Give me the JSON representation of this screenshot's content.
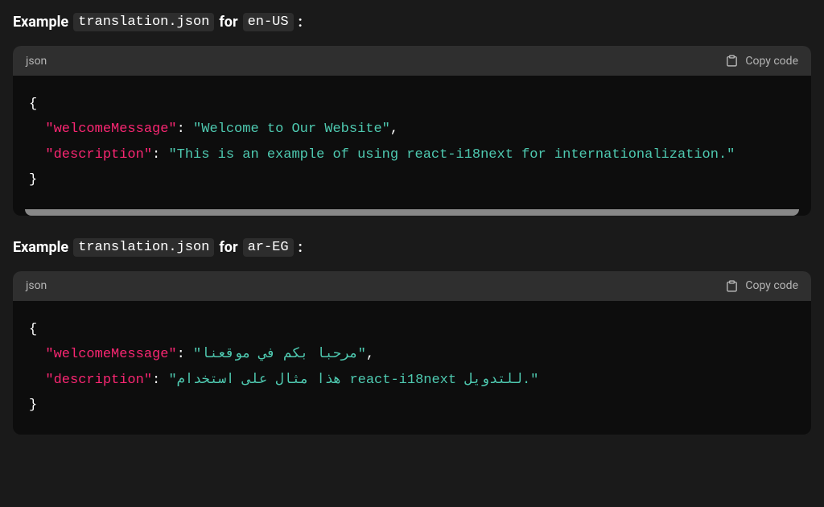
{
  "heading1": {
    "prefix": "Example",
    "code1": "translation.json",
    "mid": "for",
    "code2": "en-US",
    "suffix": ":"
  },
  "heading2": {
    "prefix": "Example",
    "code1": "translation.json",
    "mid": "for",
    "code2": "ar-EG",
    "suffix": ":"
  },
  "codeLang": "json",
  "copyLabel": "Copy code",
  "block1": {
    "key1": "\"welcomeMessage\"",
    "val1": "\"Welcome to Our Website\"",
    "key2": "\"description\"",
    "val2": "\"This is an example of using react-i18next for internationalization.\""
  },
  "block2": {
    "key1": "\"welcomeMessage\"",
    "val1": "\"مرحبا بكم في موقعنا\"",
    "key2": "\"description\"",
    "val2": "\"هذا مثال على استخدام react-i18next للتدويل.\""
  }
}
